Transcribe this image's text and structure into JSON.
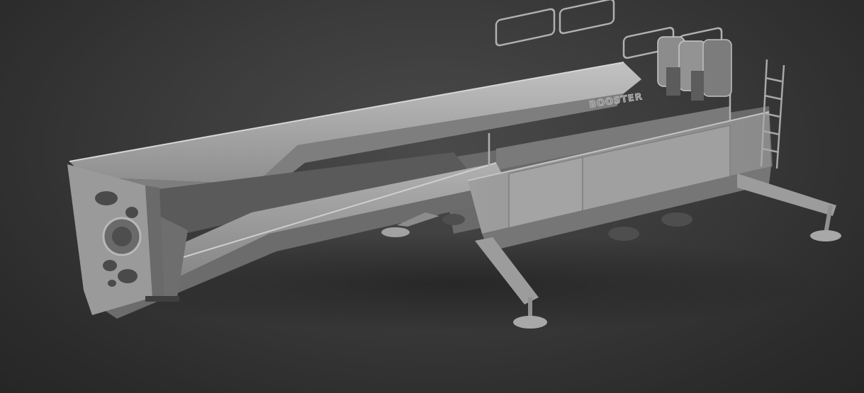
{
  "scene": {
    "subject": "booster-erector-3d-render",
    "hull_markings": [
      "BOOSTER"
    ],
    "colors": {
      "background_center": "#4a4a4a",
      "background_edge": "#262626",
      "model_light": "#b4b4b4",
      "model_mid": "#8e8e8e",
      "model_dark": "#5e5e5e"
    }
  }
}
